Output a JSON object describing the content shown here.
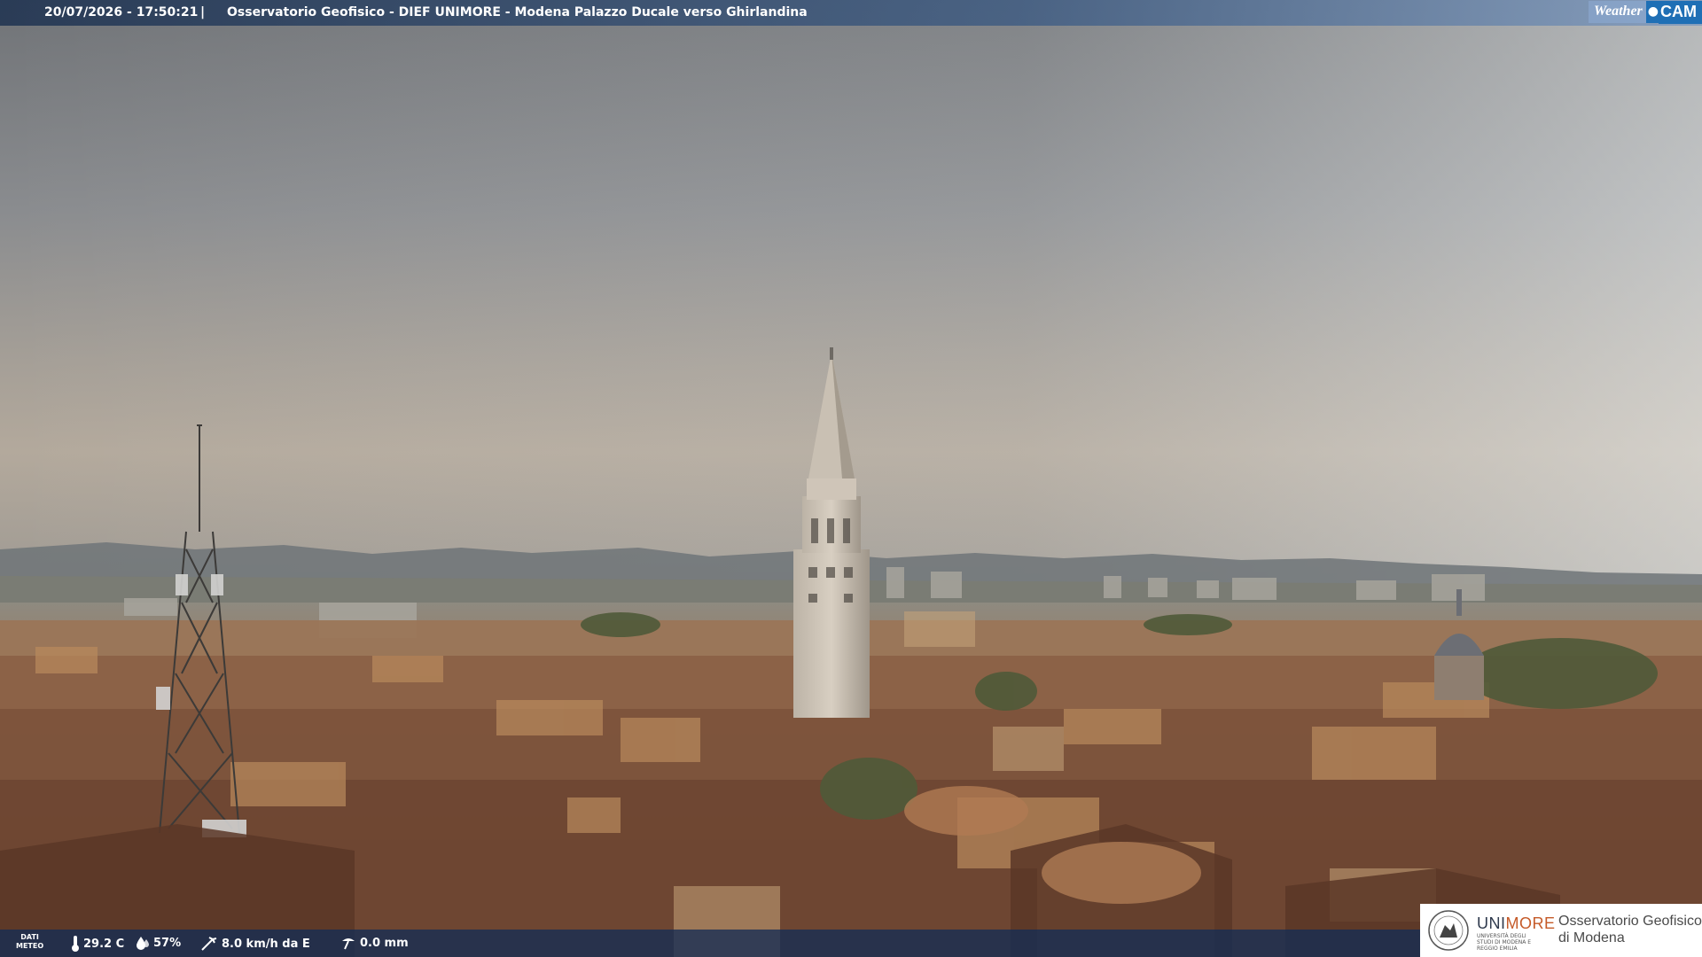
{
  "overlay": {
    "datetime": "20/07/2026 - 17:50:21",
    "separator": "|",
    "title": "Osservatorio Geofisico - DIEF UNIMORE - Modena Palazzo Ducale verso Ghirlandina",
    "brand_weather": "Weather",
    "brand_cam": "CAM"
  },
  "meteo": {
    "label_line1": "DATI",
    "label_line2": "METEO",
    "temperature": "29.2 C",
    "humidity": "57%",
    "wind": "8.0 km/h da E",
    "rain": "0.0 mm",
    "icons": [
      "thermometer-icon",
      "humidity-drop-icon",
      "wind-icon",
      "rain-gauge-icon"
    ]
  },
  "logo": {
    "name_part1": "UNI",
    "name_part2": "MORE",
    "subtitle": "UNIVERSITÀ DEGLI STUDI DI MODENA E REGGIO EMILIA",
    "obs_line1": "Osservatorio Geofisico",
    "obs_line2": "di Modena"
  },
  "colors": {
    "sky_top": "#6f7276",
    "sky_horizon": "#b8aea0",
    "roofs": "#9a6a4a",
    "bar_blue": "#1f6fb5",
    "unimore_orange": "#c55a28"
  }
}
